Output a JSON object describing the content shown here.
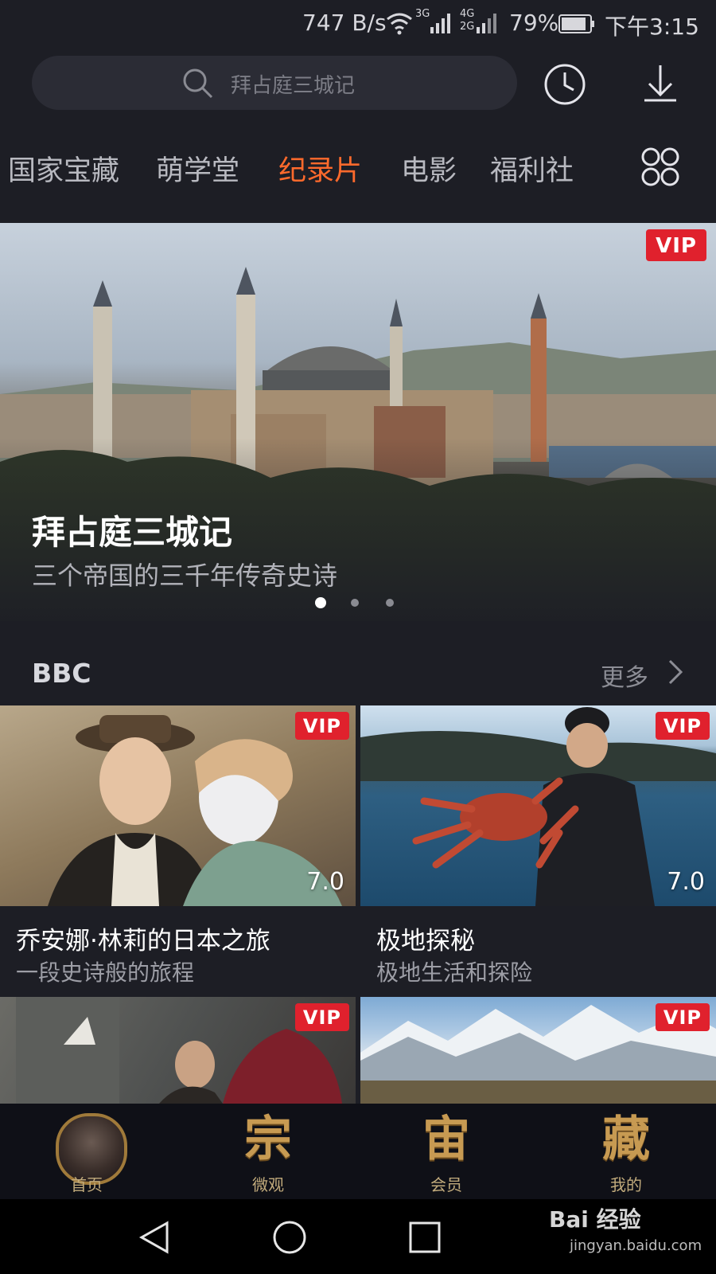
{
  "status_bar": {
    "net_speed": "747 B/s",
    "signal_3g": "3G",
    "signal_4g": "4G",
    "signal_2g": "2G",
    "battery": "79%",
    "time": "下午3:15"
  },
  "search": {
    "placeholder": "拜占庭三城记"
  },
  "tabs": [
    {
      "label": "国家宝藏"
    },
    {
      "label": "萌学堂"
    },
    {
      "label": "纪录片",
      "active": true
    },
    {
      "label": "电影"
    },
    {
      "label": "福利社"
    }
  ],
  "hero": {
    "badge": "VIP",
    "title": "拜占庭三城记",
    "subtitle": "三个帝国的三千年传奇史诗",
    "page_count": 3,
    "active_page": 1
  },
  "section": {
    "title": "BBC",
    "more_label": "更多"
  },
  "cards": [
    {
      "badge": "VIP",
      "score": "7.0",
      "title": "乔安娜·林莉的日本之旅",
      "subtitle": "一段史诗般的旅程"
    },
    {
      "badge": "VIP",
      "score": "7.0",
      "title": "极地探秘",
      "subtitle": "极地生活和探险"
    },
    {
      "badge": "VIP"
    },
    {
      "badge": "VIP"
    }
  ],
  "bottom_nav": [
    {
      "glyph": "",
      "label": "首页"
    },
    {
      "glyph": "宗",
      "label": "微观"
    },
    {
      "glyph": "宙",
      "label": "会员"
    },
    {
      "glyph": "藏",
      "label": "我的"
    }
  ],
  "watermark": {
    "brand": "Bai 经验",
    "url": "jingyan.baidu.com"
  },
  "colors": {
    "accent": "#ff6a2c",
    "vip": "#e0212d",
    "gold": "#c79a52",
    "background": "#1d1e25"
  }
}
